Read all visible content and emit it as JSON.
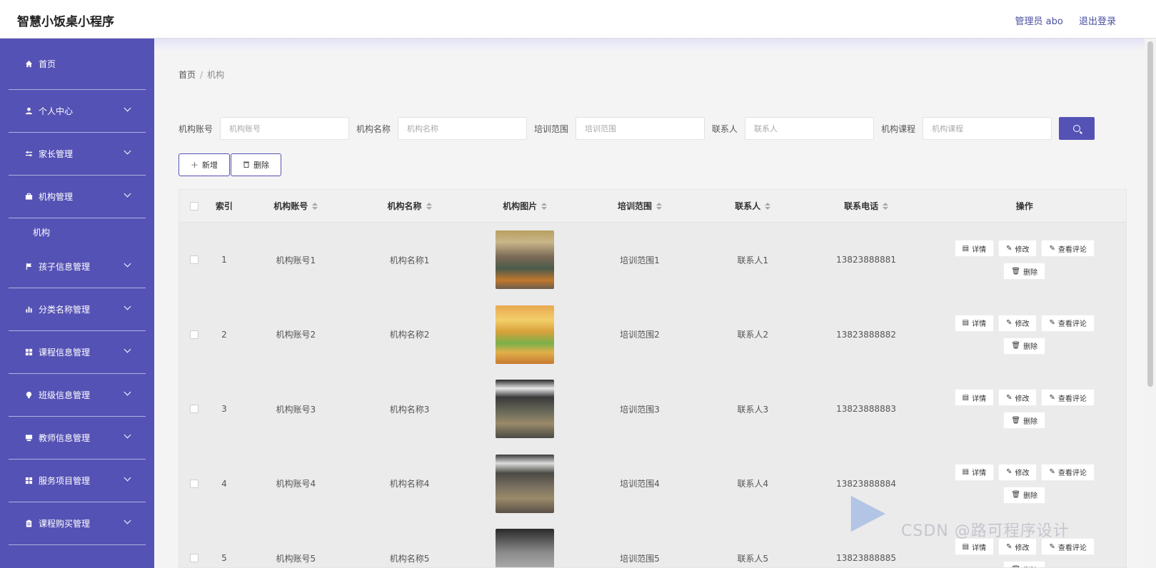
{
  "app": {
    "title": "智慧小饭桌小程序",
    "admin_label": "管理员 abo",
    "logout_label": "退出登录"
  },
  "sidebar": {
    "items": [
      {
        "label": "首页",
        "icon": "home-icon"
      },
      {
        "label": "个人中心",
        "icon": "user-icon"
      },
      {
        "label": "家长管理",
        "icon": "sliders-icon"
      },
      {
        "label": "机构管理",
        "icon": "briefcase-icon"
      },
      {
        "label": "孩子信息管理",
        "icon": "flag-icon"
      },
      {
        "label": "分类名称管理",
        "icon": "bar-chart-icon"
      },
      {
        "label": "课程信息管理",
        "icon": "grid-icon"
      },
      {
        "label": "班级信息管理",
        "icon": "bulb-icon"
      },
      {
        "label": "教师信息管理",
        "icon": "monitor-icon"
      },
      {
        "label": "服务项目管理",
        "icon": "grid-icon"
      },
      {
        "label": "课程购买管理",
        "icon": "clipboard-icon"
      }
    ],
    "sub_item": "机构"
  },
  "breadcrumb": {
    "home": "首页",
    "sep": "/",
    "current": "机构"
  },
  "filters": [
    {
      "label": "机构账号",
      "placeholder": "机构账号"
    },
    {
      "label": "机构名称",
      "placeholder": "机构名称"
    },
    {
      "label": "培训范围",
      "placeholder": "培训范围"
    },
    {
      "label": "联系人",
      "placeholder": "联系人"
    },
    {
      "label": "机构课程",
      "placeholder": "机构课程"
    }
  ],
  "toolbar": {
    "add_label": "新增",
    "delete_label": "删除"
  },
  "table": {
    "headers": {
      "index": "索引",
      "account": "机构账号",
      "name": "机构名称",
      "image": "机构图片",
      "range": "培训范围",
      "contact": "联系人",
      "phone": "联系电话",
      "ops": "操作"
    },
    "ops": {
      "detail": "详情",
      "edit": "修改",
      "reviews": "查看评论",
      "delete": "删除"
    },
    "rows": [
      {
        "index": "1",
        "account": "机构账号1",
        "name": "机构名称1",
        "range": "培训范围1",
        "contact": "联系人1",
        "phone": "13823888881"
      },
      {
        "index": "2",
        "account": "机构账号2",
        "name": "机构名称2",
        "range": "培训范围2",
        "contact": "联系人2",
        "phone": "13823888882"
      },
      {
        "index": "3",
        "account": "机构账号3",
        "name": "机构名称3",
        "range": "培训范围3",
        "contact": "联系人3",
        "phone": "13823888883"
      },
      {
        "index": "4",
        "account": "机构账号4",
        "name": "机构名称4",
        "range": "培训范围4",
        "contact": "联系人4",
        "phone": "13823888884"
      },
      {
        "index": "5",
        "account": "机构账号5",
        "name": "机构名称5",
        "range": "培训范围5",
        "contact": "联系人5",
        "phone": "13823888885"
      }
    ]
  },
  "watermark": "CSDN @路可程序设计"
}
